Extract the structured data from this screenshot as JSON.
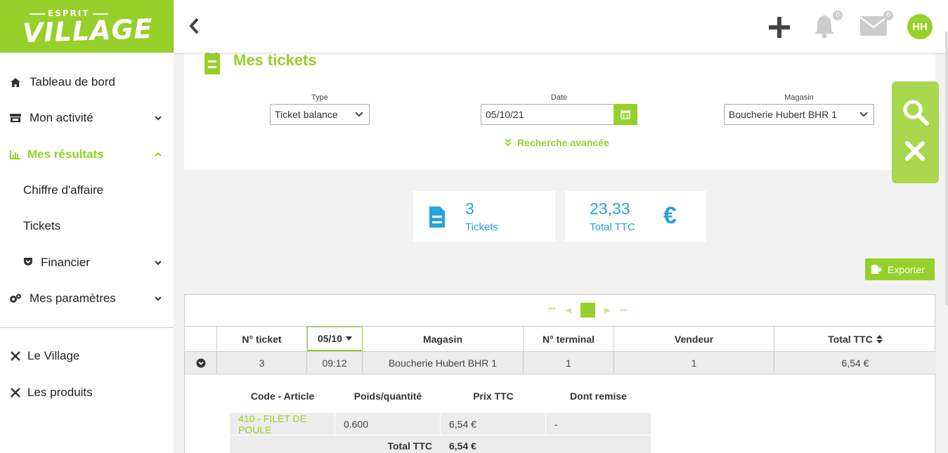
{
  "brand": {
    "top": "ESPRIT",
    "main": "VILLAGE",
    "color": "#95d12a"
  },
  "sidebar": {
    "items": [
      {
        "label": "Tableau de bord",
        "icon": "home-icon"
      },
      {
        "label": "Mon activité",
        "icon": "store-icon"
      },
      {
        "label": "Mes résultats",
        "icon": "bar-chart-icon"
      },
      {
        "label": "Chiffre d'affaire"
      },
      {
        "label": "Tickets"
      },
      {
        "label": "Financier",
        "icon": "shield-icon"
      },
      {
        "label": "Mes paramètres",
        "icon": "gears-icon"
      },
      {
        "label": "Le Village",
        "icon": "village-icon"
      },
      {
        "label": "Les produits",
        "icon": "products-icon"
      }
    ]
  },
  "header": {
    "notifications": "0",
    "messages": "0",
    "avatar": "HH"
  },
  "page": {
    "title": "Mes tickets"
  },
  "filters": {
    "type_label": "Type",
    "type_value": "Ticket balance",
    "date_label": "Date",
    "date_value": "05/10/21",
    "store_label": "Magasin",
    "store_value": "Boucherie Hubert BHR 1",
    "advanced": "Recherche avancée"
  },
  "kpis": {
    "tickets_value": "3",
    "tickets_label": "Tickets",
    "total_value": "23,33",
    "total_label": "Total TTC",
    "currency": "€"
  },
  "export_label": "Exporter",
  "table": {
    "columns": [
      "N° ticket",
      "05/10",
      "Magasin",
      "N° terminal",
      "Vendeur",
      "Total TTC"
    ],
    "rows": [
      {
        "ticket": "3",
        "time": "09:12",
        "store": "Boucherie Hubert BHR 1",
        "terminal": "1",
        "seller": "1",
        "total": "6,54 €"
      }
    ]
  },
  "detail": {
    "columns": [
      "Code - Article",
      "Poids/quantité",
      "Prix TTC",
      "Dont remise"
    ],
    "row": {
      "article": "410 - FILET DE POULE",
      "qty": "0.600",
      "price": "6,54 €",
      "discount": "-"
    },
    "total_label": "Total TTC",
    "total_value": "6,54 €"
  }
}
